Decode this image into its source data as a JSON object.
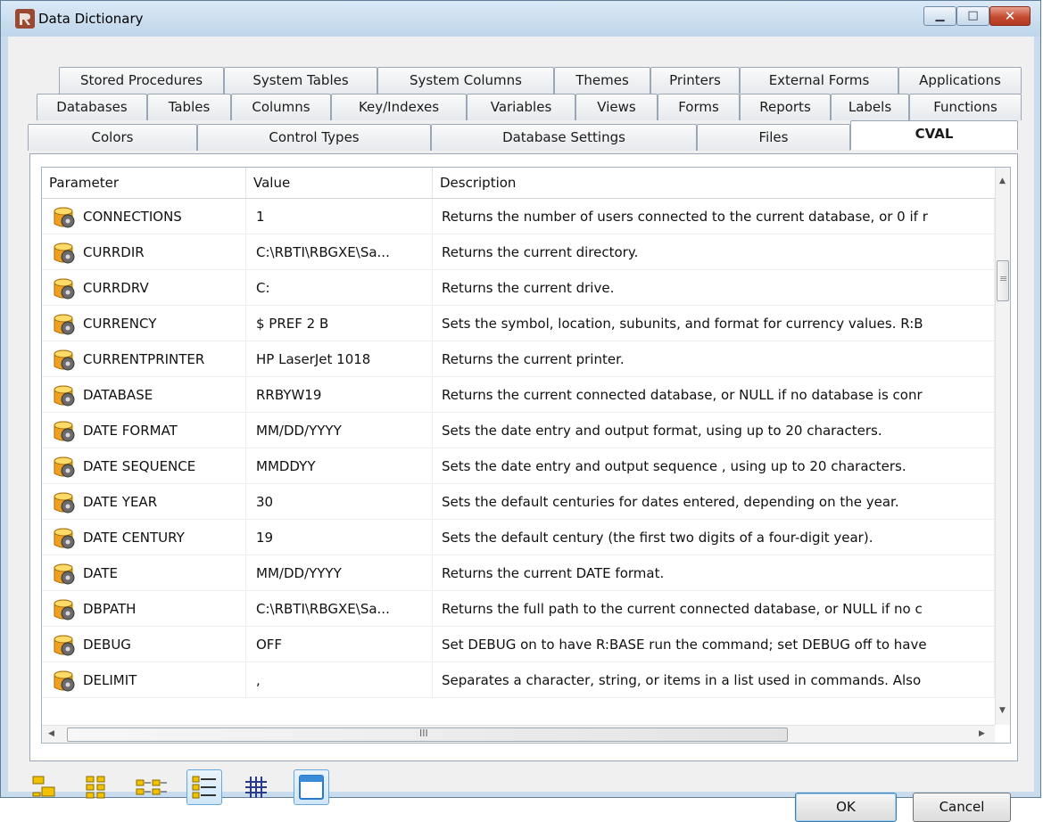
{
  "window": {
    "title": "Data Dictionary"
  },
  "tabs": {
    "row1": [
      "Stored Procedures",
      "System Tables",
      "System Columns",
      "Themes",
      "Printers",
      "External Forms",
      "Applications"
    ],
    "row2": [
      "Databases",
      "Tables",
      "Columns",
      "Key/Indexes",
      "Variables",
      "Views",
      "Forms",
      "Reports",
      "Labels",
      "Functions"
    ],
    "row3": [
      "Colors",
      "Control Types",
      "Database Settings",
      "Files",
      "CVAL"
    ],
    "active": "CVAL"
  },
  "table": {
    "columns": [
      "Parameter",
      "Value",
      "Description"
    ],
    "rows": [
      {
        "parameter": "CONNECTIONS",
        "value": "1",
        "description": "Returns the number of users connected to the current database, or 0 if r"
      },
      {
        "parameter": "CURRDIR",
        "value": "C:\\RBTI\\RBGXE\\Sa...",
        "description": "Returns the current directory."
      },
      {
        "parameter": "CURRDRV",
        "value": "C:",
        "description": "Returns the current drive."
      },
      {
        "parameter": "CURRENCY",
        "value": "$ PREF  2 B",
        "description": "Sets the symbol, location, subunits, and format for currency values. R:B"
      },
      {
        "parameter": "CURRENTPRINTER",
        "value": "HP LaserJet 1018",
        "description": "Returns the current printer."
      },
      {
        "parameter": "DATABASE",
        "value": "RRBYW19",
        "description": "Returns the current connected database, or NULL if no database is conr"
      },
      {
        "parameter": "DATE FORMAT",
        "value": "MM/DD/YYYY",
        "description": "Sets the date entry and output format, using up to 20 characters."
      },
      {
        "parameter": "DATE SEQUENCE",
        "value": "MMDDYY",
        "description": "Sets the date entry and output sequence , using up to 20 characters."
      },
      {
        "parameter": "DATE YEAR",
        "value": "30",
        "description": "Sets the default centuries for dates entered, depending on the year."
      },
      {
        "parameter": "DATE CENTURY",
        "value": "19",
        "description": "Sets the default century (the first two digits of a four-digit year)."
      },
      {
        "parameter": "DATE",
        "value": "MM/DD/YYYY",
        "description": "Returns the current DATE format."
      },
      {
        "parameter": "DBPATH",
        "value": "C:\\RBTI\\RBGXE\\Sa...",
        "description": "Returns the full path to the current connected database, or NULL if no c"
      },
      {
        "parameter": "DEBUG",
        "value": "OFF",
        "description": "Set DEBUG on to have R:BASE run the command; set DEBUG off to have"
      },
      {
        "parameter": "DELIMIT",
        "value": ",",
        "description": "Separates a character, string, or items in a list used in commands. Also"
      }
    ]
  },
  "scroll": {
    "h_grip": "III",
    "v_grip": "≡"
  },
  "buttons": {
    "ok": "OK",
    "cancel": "Cancel"
  },
  "view_buttons": [
    "large-icons-icon",
    "small-icons-icon",
    "list-icon",
    "details-icon",
    "grid-icon",
    "form-icon"
  ],
  "colors": {
    "accent": "#6aa6d8",
    "close": "#c44b31"
  }
}
